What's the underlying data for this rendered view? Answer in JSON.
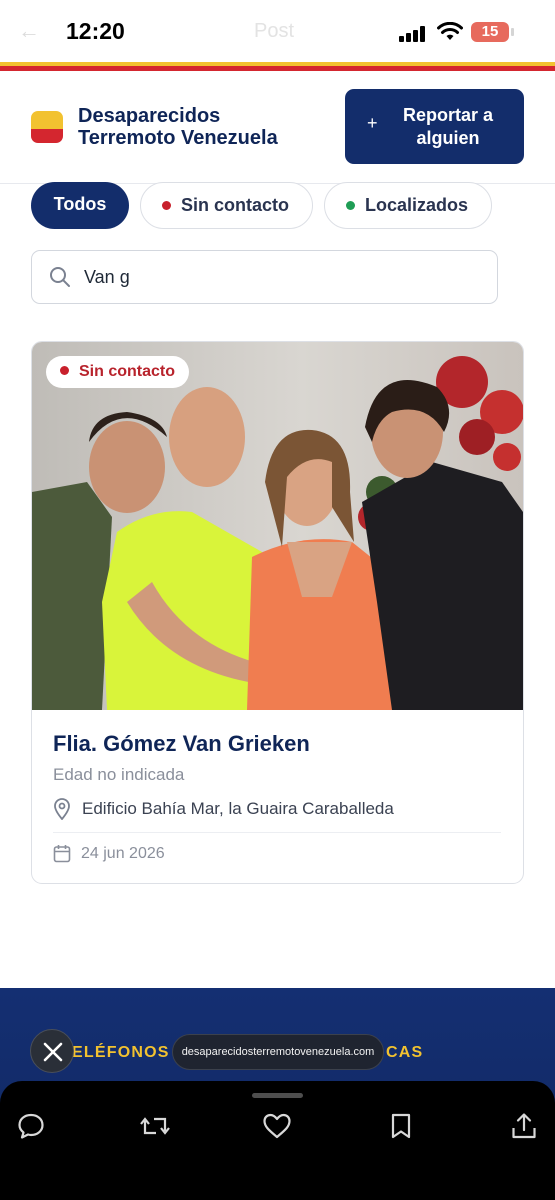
{
  "status_bar": {
    "time": "12:20",
    "app_name": "Post",
    "battery": "15"
  },
  "header": {
    "brand_line1": "Desaparecidos",
    "brand_line2": "Terremoto Venezuela",
    "report_button_plus": "+",
    "report_button_line1": "Reportar a",
    "report_button_line2": "alguien"
  },
  "filters": {
    "all": "Todos",
    "no_contact": "Sin contacto",
    "found": "Localizados"
  },
  "search": {
    "value": "Van g"
  },
  "card": {
    "badge": "Sin contacto",
    "name": "Flia. Gómez Van Grieken",
    "age": "Edad no indicada",
    "location": "Edificio Bahía Mar, la Guaira Caraballeda",
    "date": "24 jun 2026"
  },
  "footer": {
    "left_text": "ELÉFONOS",
    "right_text": "CAS"
  },
  "browser": {
    "url": "desaparecidosterremotovenezuela.com"
  },
  "colors": {
    "navy": "#132d6b",
    "flag_yellow": "#f2c230",
    "flag_red": "#d4262f",
    "status_green": "#1f9d55"
  }
}
